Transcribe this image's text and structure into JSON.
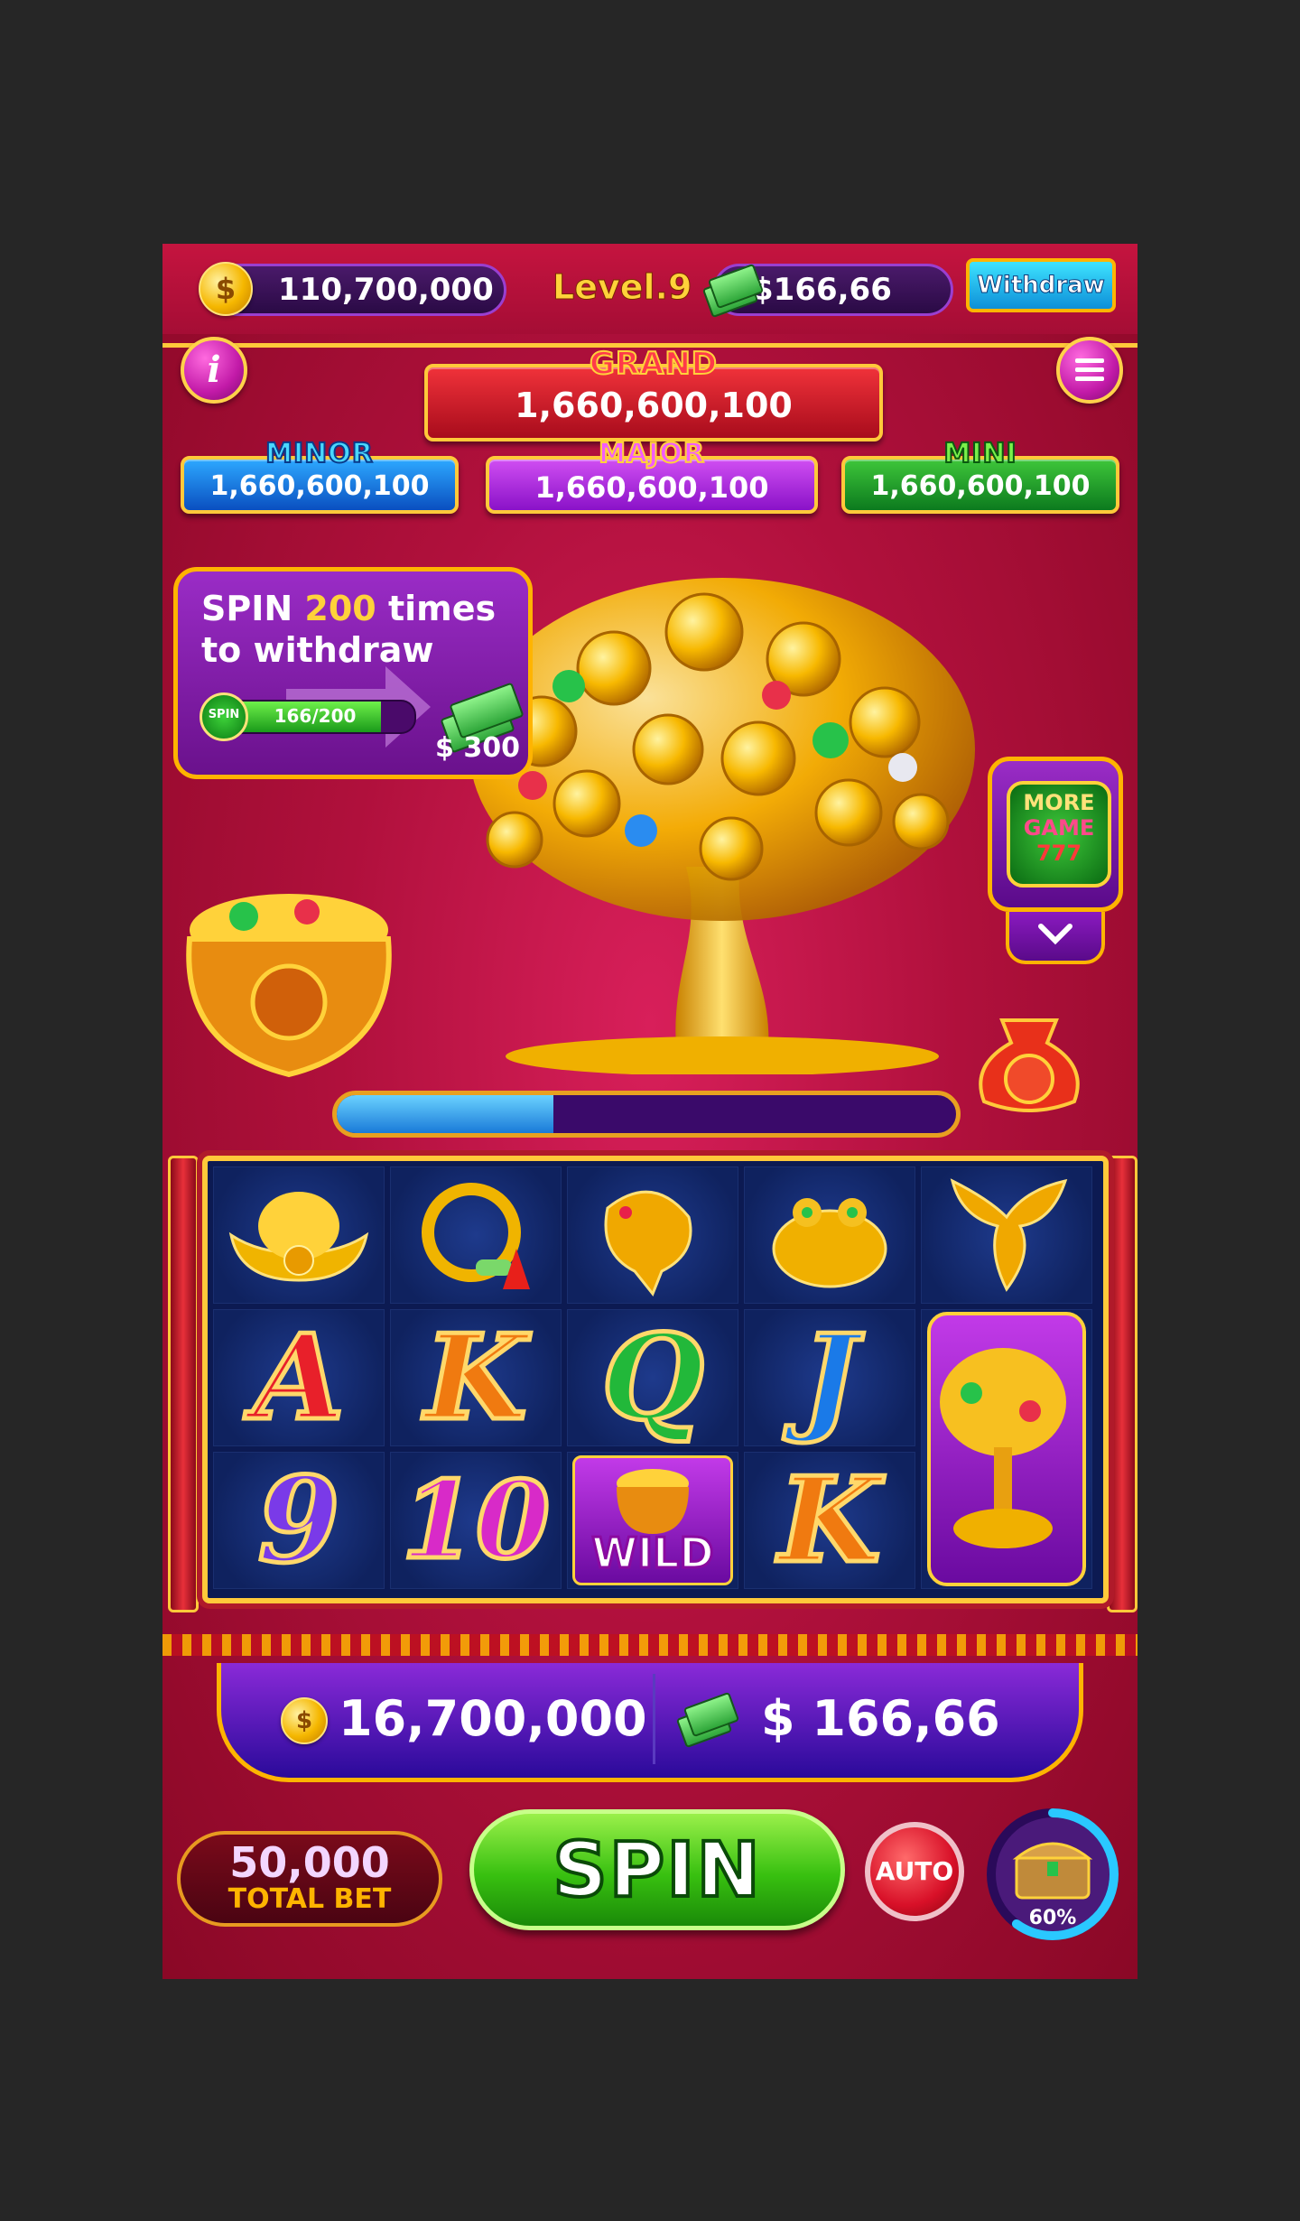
{
  "top_bar": {
    "coins": "110,700,000",
    "level": "Level.9",
    "cash": "$166,66",
    "withdraw_label": "Withdraw"
  },
  "buttons": {
    "info": "i"
  },
  "jackpots": {
    "grand": {
      "label": "GRAND",
      "value": "1,660,600,100"
    },
    "minor": {
      "label": "MINOR",
      "value": "1,660,600,100"
    },
    "major": {
      "label": "MAJOR",
      "value": "1,660,600,100"
    },
    "mini": {
      "label": "MINI",
      "value": "1,660,600,100"
    }
  },
  "withdraw_task": {
    "line1_prefix": "SPIN",
    "line1_count": "200",
    "line1_suffix": "times",
    "line2": "to withdraw",
    "spin_badge": "SPIN",
    "progress_text": "166/200",
    "progress_fraction": 0.83,
    "reward": "$ 300"
  },
  "more_game": {
    "line1": "MORE",
    "line2": "GAME",
    "line3": "777"
  },
  "tree_progress_fraction": 0.35,
  "reels": {
    "row2": [
      "A",
      "K",
      "Q",
      "J"
    ],
    "row3": [
      "9",
      "10",
      "WILD",
      "K"
    ]
  },
  "balance_bar": {
    "coins": "16,700,000",
    "cash": "$ 166,66"
  },
  "total_bet": {
    "value": "50,000",
    "label": "TOTAL BET"
  },
  "spin_button": "SPIN",
  "auto_button": "AUTO",
  "chest_percent": "60%",
  "chest_fraction": 0.6,
  "colors": {
    "bg_red": "#b0103c",
    "gold": "#ffc93a",
    "purple": "#7a1aa8",
    "spin_green": "#44d21a"
  },
  "icons": [
    "coin-icon",
    "cash-icon",
    "info-icon",
    "menu-icon",
    "chevron-down-icon",
    "treasure-chest-icon"
  ]
}
